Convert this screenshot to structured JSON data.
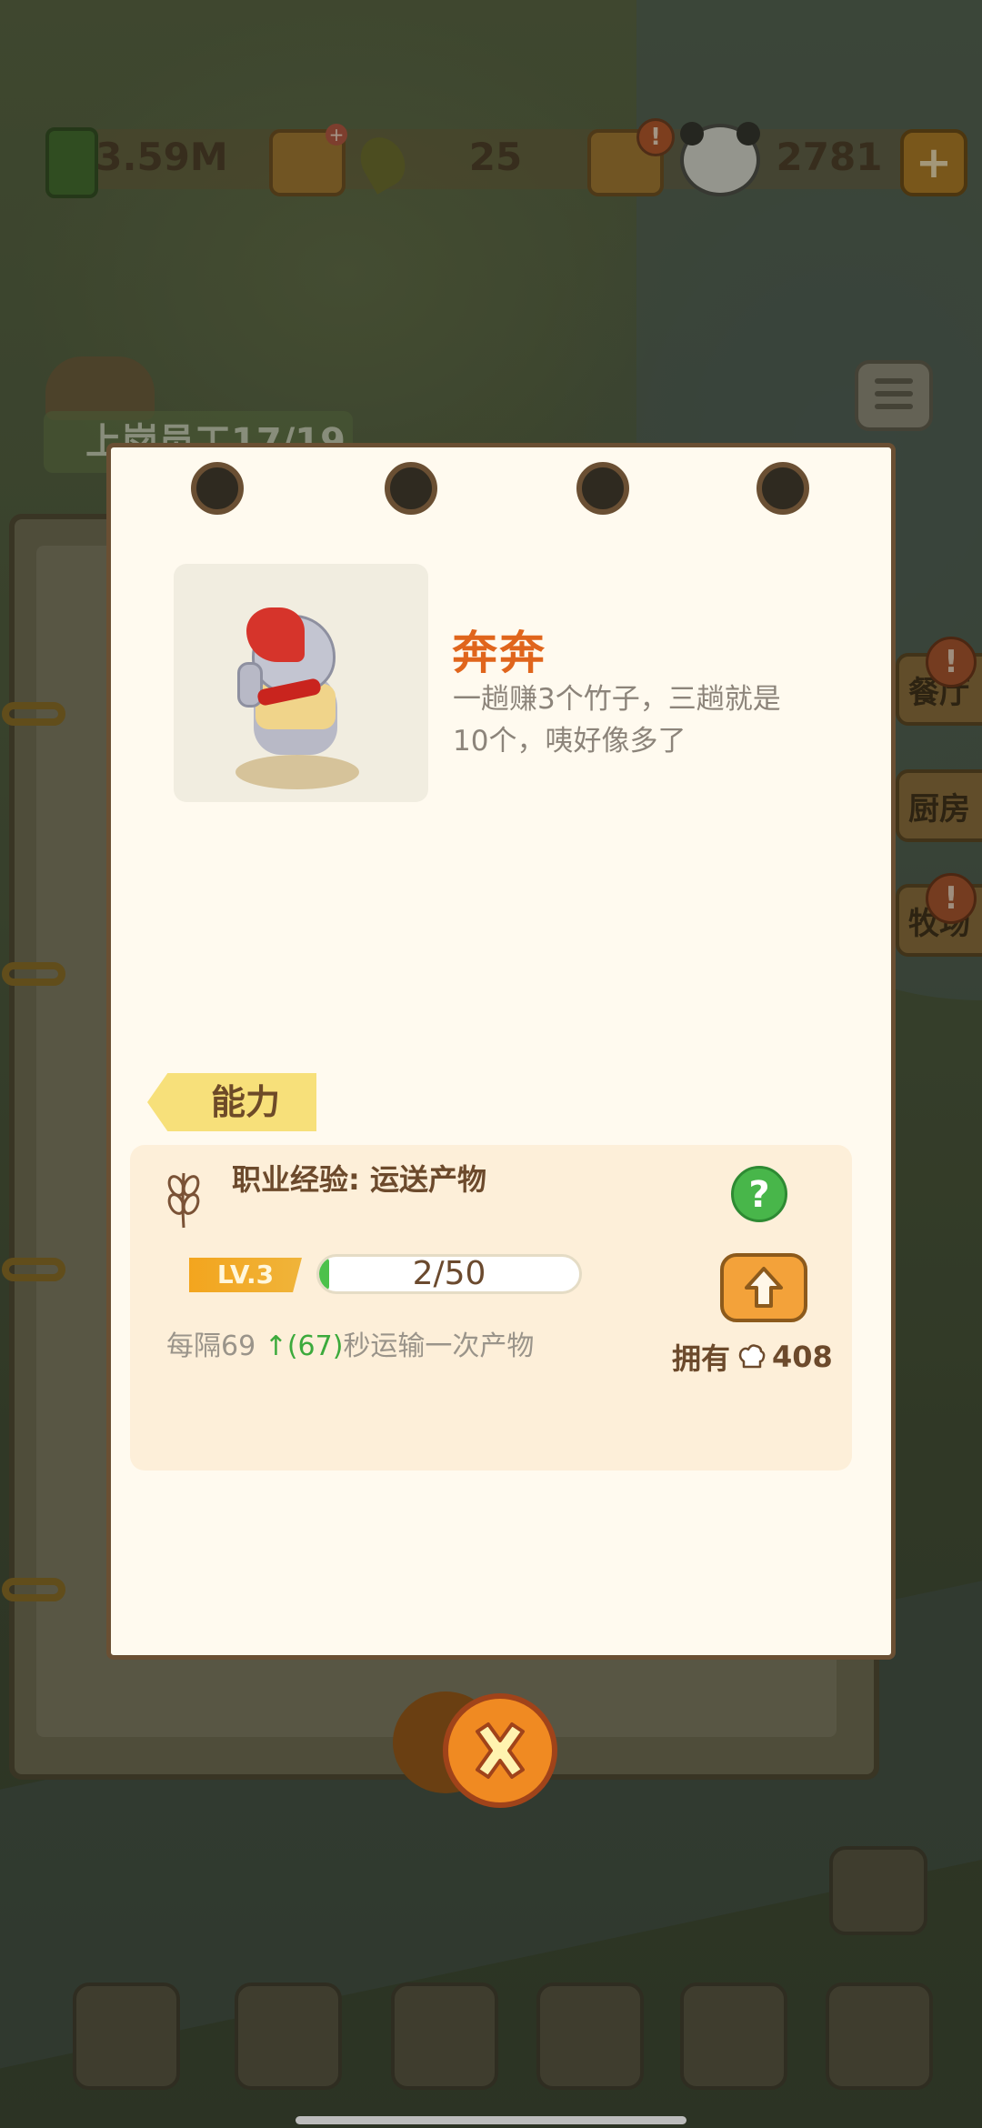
{
  "resources": {
    "bamboo": "3.59M",
    "middle_count": "25",
    "panda_count": "2781",
    "plus_badge": "+",
    "alert_badge": "!",
    "add_label": "+"
  },
  "background": {
    "staff_label": "上岗员工17/19",
    "side_tags": [
      "餐厅",
      "厨房",
      "牧场"
    ],
    "alert_badge": "!"
  },
  "character": {
    "name": "奔奔",
    "description": "一趟赚3个竹子，三趟就是10个，咦好像多了"
  },
  "ability": {
    "tag": "能力",
    "exp_label": "职业经验: 运送产物",
    "help": "?",
    "level": "LV.3",
    "progress_text": "2/50",
    "progress_fraction": 0.04,
    "interval_prefix": "每隔69 ",
    "interval_upgrade": "↑(67)",
    "interval_suffix": "秒运输一次产物",
    "own_label": "拥有",
    "own_count": "408"
  },
  "colors": {
    "name": "#e0651c",
    "accent_orange": "#f3a23a",
    "progress_green": "#4cc14b",
    "help_green": "#48b64a"
  },
  "icons": {
    "close": "close-icon",
    "upgrade": "arrow-up-icon",
    "help": "question-icon",
    "wheat": "wheat-icon",
    "chef": "chef-hat-icon"
  }
}
